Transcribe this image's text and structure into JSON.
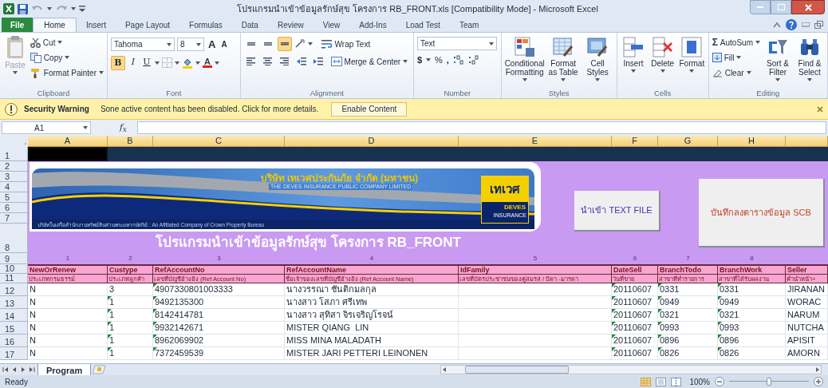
{
  "window": {
    "title": "โปรแกรมนำเข้าข้อมูลรักษ์สุข โครงการ RB_FRONT.xls [Compatibility Mode] - Microsoft Excel"
  },
  "ribbon_tabs": [
    {
      "label": "File",
      "kind": "file",
      "selected": false
    },
    {
      "label": "Home",
      "kind": "tab",
      "selected": true
    },
    {
      "label": "Insert",
      "kind": "tab",
      "selected": false
    },
    {
      "label": "Page Layout",
      "kind": "tab",
      "selected": false
    },
    {
      "label": "Formulas",
      "kind": "tab",
      "selected": false
    },
    {
      "label": "Data",
      "kind": "tab",
      "selected": false
    },
    {
      "label": "Review",
      "kind": "tab",
      "selected": false
    },
    {
      "label": "View",
      "kind": "tab",
      "selected": false
    },
    {
      "label": "Add-Ins",
      "kind": "tab",
      "selected": false
    },
    {
      "label": "Load Test",
      "kind": "tab",
      "selected": false
    },
    {
      "label": "Team",
      "kind": "tab",
      "selected": false
    }
  ],
  "ribbon_groups": [
    {
      "kind": "clipboard",
      "label": "Clipboard",
      "paste": {
        "label": "Paste",
        "disabled": true
      },
      "items": [
        "Cut",
        "Copy",
        "Format Painter"
      ]
    },
    {
      "kind": "font",
      "label": "Font",
      "font": "Tahoma",
      "size": "8",
      "size_buttons": [
        "A",
        "A"
      ],
      "styles": [
        "B",
        "I",
        "U"
      ],
      "bold": true,
      "color_letter": "A"
    },
    {
      "kind": "alignment",
      "label": "Alignment",
      "items": [
        "Wrap Text",
        "Merge & Center"
      ],
      "bottom_align": true
    },
    {
      "kind": "number",
      "label": "Number",
      "format": "Text",
      "symbols": [
        "$",
        "%",
        ","
      ]
    },
    {
      "kind": "styles",
      "label": "Styles",
      "items": [
        "Conditional Formatting",
        "Format as Table",
        "Cell Styles"
      ]
    },
    {
      "kind": "cells",
      "label": "Cells",
      "items": [
        "Insert",
        "Delete",
        "Format"
      ]
    },
    {
      "kind": "editing",
      "label": "Editing",
      "small": [
        {
          "symbol": "Σ",
          "label": "AutoSum"
        },
        {
          "label": "Fill"
        },
        {
          "label": "Clear"
        }
      ],
      "large": [
        "Sort & Filter",
        "Find & Select"
      ]
    }
  ],
  "security_bar": {
    "title": "Security Warning",
    "message": "Sone active content has been disabled. Click for more details.",
    "button": "Enable Content"
  },
  "formula_bar": {
    "name_box": "A1",
    "function_label": "f$_{x}$"
  },
  "sheet": {
    "column_headers": [
      "A",
      "B",
      "C",
      "D",
      "E",
      "F",
      "G",
      "H"
    ],
    "row_headers": [
      "1",
      "2",
      "3",
      "4",
      "5",
      "6",
      "7",
      "8",
      "9",
      "10",
      "11",
      "12",
      "13",
      "14",
      "15",
      "16",
      "17"
    ],
    "banner": {
      "company_th": "บริษัท เทเวศประกันภัย จำกัด (มหาชน)",
      "company_en": "THE DEVES INSURANCE PUBLIC COMPANY LIMITED",
      "tagline": "บริษัทในเครือสำนักงานทรัพย์สินส่วนพระมหากษัตริย์ : An Affiliated Company of Crown Property Bureau",
      "logo_th": "เทเวศ",
      "logo_en": "DEVES",
      "logo_sub": "INSURANCE"
    },
    "buttons": [
      {
        "label": "นำเข้า TEXT FILE",
        "kind": "import"
      },
      {
        "label": "บันทึกลงตารางข้อมูล SCB",
        "kind": "save"
      }
    ],
    "title": "โปรแกรมนำเข้าข้อมูลรักษ์สุข โครงการ RB_FRONT",
    "column_numbers": [
      "1",
      "2",
      "3",
      "4",
      "5",
      "6",
      "7",
      "8"
    ],
    "columns": [
      {
        "name": "NewOrRenew",
        "description": "ประเภทกรมธรรม์"
      },
      {
        "name": "Custype",
        "description": "ประเภทลูกค้า"
      },
      {
        "name": "RefAccountNo",
        "description": "เลขที่บัญชีอ้างอิง (Ref Account No)"
      },
      {
        "name": "RefAccountName",
        "description": "ชื่อเจ้าของเลขที่บัญชีอ้างอิง (Ref Account Name)"
      },
      {
        "name": "IdFamily",
        "description": "เลขที่บัตรประชาชนของคู่สมรส / บิดา -มารดา"
      },
      {
        "name": "DateSell",
        "description": "วันที่ขาย"
      },
      {
        "name": "BranchTodo",
        "description": "สาขาที่ทำรายการ"
      },
      {
        "name": "BranchWork",
        "description": "สาขาที่ได้รับผลงาน"
      },
      {
        "name": "Seller",
        "description": "คำนำหน้า+"
      }
    ],
    "rows": [
      {
        "cells": [
          "N",
          "3",
          "4907330801003333",
          "นางวรรณา ชันติกมลกุล",
          "",
          "20110607",
          "0331",
          "0331",
          "JIRANAN"
        ],
        "marked": [
          false,
          false,
          true,
          false,
          false,
          true,
          true,
          true,
          false
        ]
      },
      {
        "cells": [
          "N",
          "1",
          "9492135300",
          "นางสาว โสภา ศรีเทพ",
          "",
          "20110607",
          "0949",
          "0949",
          "WORAC"
        ],
        "marked": [
          false,
          true,
          true,
          false,
          false,
          true,
          true,
          true,
          false
        ]
      },
      {
        "cells": [
          "N",
          "1",
          "8142414781",
          "นางสาว สุทิสา จิรเจริญโรจน์",
          "",
          "20110607",
          "0321",
          "0321",
          "NARUM"
        ],
        "marked": [
          false,
          true,
          true,
          false,
          false,
          true,
          true,
          true,
          false
        ]
      },
      {
        "cells": [
          "N",
          "1",
          "9932142671",
          "MISTER QIANG  LIN",
          "",
          "20110607",
          "0993",
          "0993",
          "NUTCHA"
        ],
        "marked": [
          false,
          true,
          true,
          false,
          false,
          true,
          true,
          true,
          false
        ]
      },
      {
        "cells": [
          "N",
          "1",
          "8962069902",
          "MISS MINA MALADATH",
          "",
          "20110607",
          "0896",
          "0896",
          "APISIT"
        ],
        "marked": [
          false,
          true,
          true,
          false,
          false,
          true,
          true,
          true,
          false
        ]
      },
      {
        "cells": [
          "N",
          "1",
          "7372459539",
          "MISTER JARI PETTERI LEINONEN",
          "",
          "20110607",
          "0826",
          "0826",
          "AMORN"
        ],
        "marked": [
          false,
          true,
          true,
          false,
          false,
          true,
          true,
          true,
          false
        ]
      }
    ]
  },
  "sheet_tabs": [
    {
      "label": "Program",
      "selected": true
    }
  ],
  "status_bar": {
    "status": "Ready",
    "zoom": "100%",
    "zoom_slider": {
      "level": 0.5
    }
  }
}
